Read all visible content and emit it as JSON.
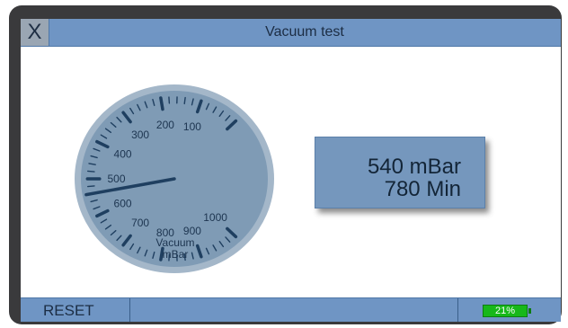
{
  "window": {
    "title": "Vacuum test",
    "close_label": "X"
  },
  "gauge": {
    "name": "vacuum-gauge",
    "label_line1": "Vacuum",
    "label_line2": "mBar",
    "scale_labels": [
      "1000",
      "900",
      "800",
      "700",
      "600",
      "500",
      "400",
      "300",
      "200",
      "100"
    ],
    "needle_value": 540,
    "colors": {
      "face": "#7f9bb5",
      "rim": "#a4b7c9",
      "ticks": "#1f3f60",
      "needle": "#1f3f60"
    }
  },
  "readout": {
    "pressure": "540 mBar",
    "time": "780 Min"
  },
  "footer": {
    "reset_label": "RESET",
    "battery_percent": "21%",
    "battery_level": 0.21
  },
  "colors": {
    "bar": "#6f95c4",
    "readout_bg": "#7597bd",
    "battery": "#17b81a"
  }
}
